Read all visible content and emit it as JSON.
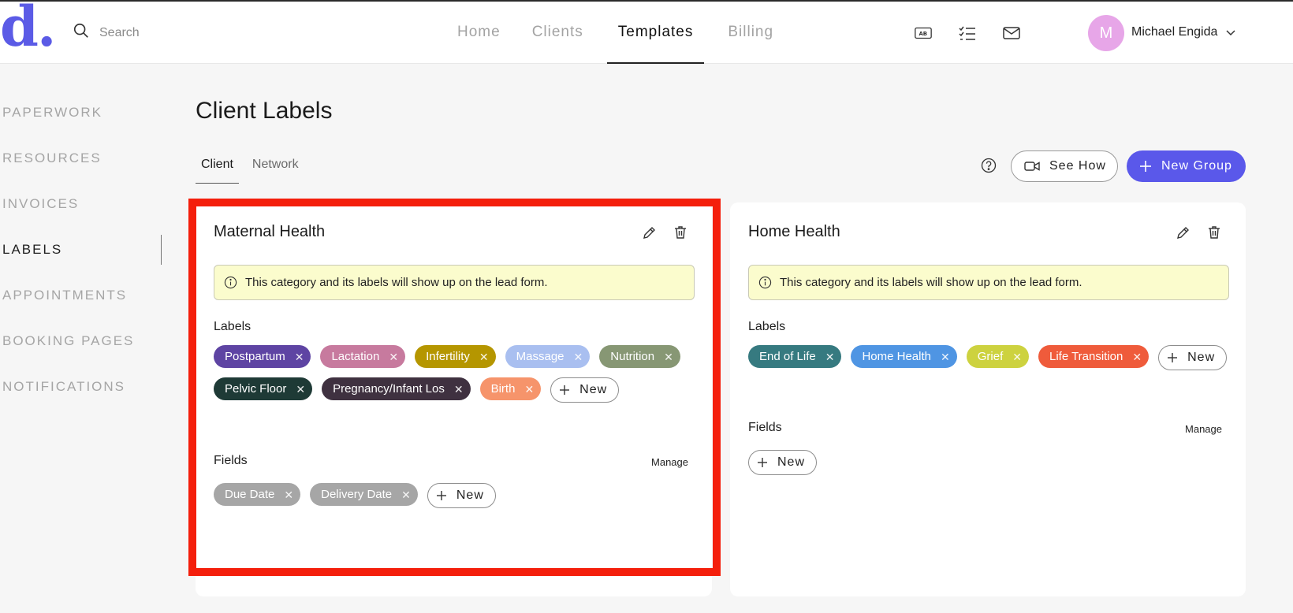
{
  "app": {
    "logo_text": "d."
  },
  "search": {
    "placeholder": "Search"
  },
  "nav": {
    "items": [
      "Home",
      "Clients",
      "Templates",
      "Billing"
    ],
    "active": "Templates"
  },
  "user": {
    "initial": "M",
    "name": "Michael Engida",
    "avatar_color": "#e7a6e8"
  },
  "header_icons": [
    "ab-icon",
    "checklist-icon",
    "mail-icon"
  ],
  "sidebar": {
    "items": [
      "PAPERWORK",
      "RESOURCES",
      "INVOICES",
      "LABELS",
      "APPOINTMENTS",
      "BOOKING PAGES",
      "NOTIFICATIONS"
    ],
    "active": "LABELS"
  },
  "page": {
    "title": "Client Labels",
    "tabs": [
      "Client",
      "Network"
    ],
    "active_tab": "Client",
    "see_how_label": "See How",
    "new_group_label": "New Group",
    "accent": "#5a58ea"
  },
  "groups": [
    {
      "title": "Maternal Health",
      "info": "This category and its labels will show up on the lead form.",
      "labels_heading": "Labels",
      "labels": [
        {
          "text": "Postpartum",
          "color": "#5e44a3"
        },
        {
          "text": "Lactation",
          "color": "#c77a9e"
        },
        {
          "text": "Infertility",
          "color": "#b59600"
        },
        {
          "text": "Massage",
          "color": "#a9bff0"
        },
        {
          "text": "Nutrition",
          "color": "#879774"
        },
        {
          "text": "Pelvic Floor",
          "color": "#1e3a36"
        },
        {
          "text": "Pregnancy/Infant Los",
          "color": "#3f3140"
        },
        {
          "text": "Birth",
          "color": "#f6946b"
        }
      ],
      "new_label": "New",
      "fields_heading": "Fields",
      "manage_label": "Manage",
      "fields": [
        {
          "text": "Due Date",
          "color": "#a6a6a6"
        },
        {
          "text": "Delivery Date",
          "color": "#a6a6a6"
        }
      ],
      "highlighted": true
    },
    {
      "title": "Home Health",
      "info": "This category and its labels will show up on the lead form.",
      "labels_heading": "Labels",
      "labels": [
        {
          "text": "End of Life",
          "color": "#367a80"
        },
        {
          "text": "Home Health",
          "color": "#4f95e3"
        },
        {
          "text": "Grief",
          "color": "#cdd23f"
        },
        {
          "text": "Life Transition",
          "color": "#ef5b3b"
        }
      ],
      "new_label": "New",
      "fields_heading": "Fields",
      "manage_label": "Manage",
      "fields": [],
      "highlighted": false
    }
  ]
}
